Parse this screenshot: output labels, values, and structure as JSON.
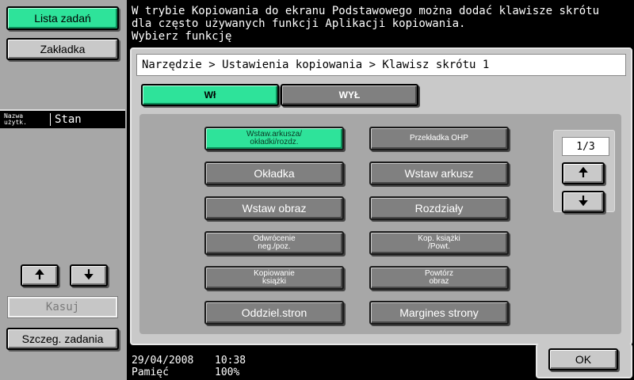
{
  "left": {
    "job_list": "Lista zadań",
    "bookmark": "Zakładka",
    "user_header_small": "Nazwa\nużytk.",
    "user_header_status": "Stan",
    "delete": "Kasuj",
    "job_details": "Szczeg. zadania"
  },
  "message": "W trybie Kopiowania do ekranu Podstawowego można dodać klawisze skrótu\ndla często używanych funkcji Aplikacji kopiowania.\nWybierz funkcję",
  "breadcrumb": "Narzędzie > Ustawienia kopiowania > Klawisz skrótu 1",
  "toggle": {
    "on": "Wł",
    "off": "WYŁ",
    "selected": "on"
  },
  "functions": [
    {
      "label": "Wstaw.arkusza/\nokładki/rozdz.",
      "selected": true,
      "small": true
    },
    {
      "label": "Przekładka OHP",
      "selected": false,
      "small": true
    },
    {
      "label": "Okładka",
      "selected": false,
      "small": false
    },
    {
      "label": "Wstaw arkusz",
      "selected": false,
      "small": false
    },
    {
      "label": "Wstaw obraz",
      "selected": false,
      "small": false
    },
    {
      "label": "Rozdziały",
      "selected": false,
      "small": false
    },
    {
      "label": "Odwrócenie\nneg./poz.",
      "selected": false,
      "small": true
    },
    {
      "label": "Kop. książki\n/Powt.",
      "selected": false,
      "small": true
    },
    {
      "label": "Kopiowanie\nksiążki",
      "selected": false,
      "small": true
    },
    {
      "label": "Powtórz\nobraz",
      "selected": false,
      "small": true
    },
    {
      "label": "Oddziel.stron",
      "selected": false,
      "small": false
    },
    {
      "label": "Margines strony",
      "selected": false,
      "small": false
    }
  ],
  "pager": {
    "current": "1/3"
  },
  "status": {
    "date": "29/04/2008",
    "time": "10:38",
    "memory_label": "Pamięć",
    "memory_value": "100%"
  },
  "ok": "OK",
  "colors": {
    "accent": "#2ee39a",
    "panel": "#c9c9c9",
    "inner": "#a7a7a7",
    "button": "#808080"
  }
}
